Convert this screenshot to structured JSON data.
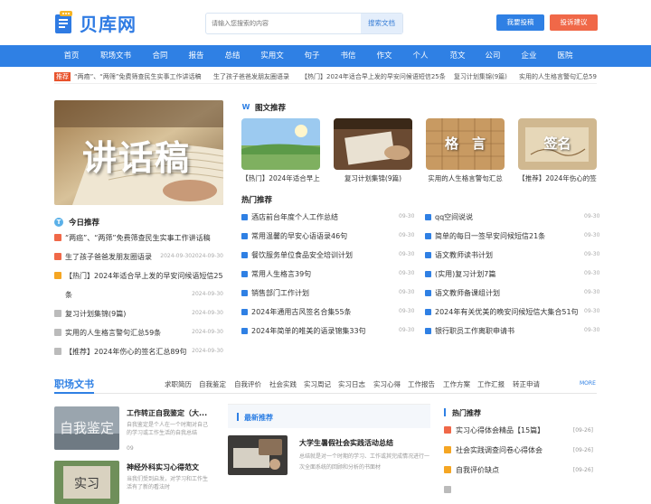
{
  "header": {
    "logo_text": "贝库网",
    "search_placeholder": "请输入您搜索的内容",
    "search_button": "搜索文档",
    "submit_button": "我要投稿",
    "complain_button": "投诉建议"
  },
  "colors": {
    "brand": "#2f80e4",
    "accent": "#f06848",
    "tag_red": "#e8532c"
  },
  "nav": [
    "首页",
    "职场文书",
    "合同",
    "报告",
    "总结",
    "实用文",
    "句子",
    "书信",
    "作文",
    "个人",
    "范文",
    "公司",
    "企业",
    "医院"
  ],
  "ticker": {
    "tag": "推荐",
    "items": [
      "“两癌”、“两筛”免费筛查民生实事工作讲话稿",
      "生了孩子爸爸发朋友圈语录",
      "【热门】2024年适合早上发的早安问候语短信25条",
      "复习计划集锦(9篇)",
      "实用的人生格言警句汇总59"
    ]
  },
  "hero": {
    "text": "讲话稿"
  },
  "today": {
    "title": "今日推荐",
    "icon": "T",
    "items": [
      {
        "text": "“两癌”、“两筛”免费筛查民生实事工作讲话稿",
        "date": ""
      },
      {
        "text": "生了孩子爸爸发朋友圈语录",
        "date": "2024-09-302024-09-30"
      },
      {
        "text": "【热门】2024年适合早上发的早安问候语短信25",
        "date": ""
      },
      {
        "text": "条",
        "date": "2024-09-30"
      },
      {
        "text": "复习计划集锦(9篇)",
        "date": "2024-09-30"
      },
      {
        "text": "实用的人生格言警句汇总59条",
        "date": "2024-09-30"
      },
      {
        "text": "【推荐】2024年伤心的签名汇总89句",
        "date": "2024-09-30"
      }
    ]
  },
  "pictures": {
    "title": "图文推荐",
    "icon": "W",
    "cards": [
      {
        "caption": "【热门】2024年适合早上",
        "icon": "sky-meadow-photo",
        "overlay": ""
      },
      {
        "caption": "复习计划集锦(9篇)",
        "icon": "desk-writing-photo",
        "overlay": ""
      },
      {
        "caption": "实用的人生格言警句汇总",
        "icon": "calligraphy-photo",
        "overlay": "格　言"
      },
      {
        "caption": "【推荐】2024年伤心的签",
        "icon": "signature-photo",
        "overlay": "签名"
      }
    ]
  },
  "hot": {
    "title": "热门推荐",
    "left": [
      {
        "text": "酒店前台年度个人工作总结",
        "date": "09-30"
      },
      {
        "text": "常用温馨的早安心语语录46句",
        "date": "09-30"
      },
      {
        "text": "餐饮服务单位食品安全培训计划",
        "date": "09-30"
      },
      {
        "text": "常用人生格言39句",
        "date": "09-30"
      },
      {
        "text": "销售部门工作计划",
        "date": "09-30"
      },
      {
        "text": "2024年通用古风签名合集55条",
        "date": "09-30"
      },
      {
        "text": "2024年简单的唯美的语录锦集33句",
        "date": "09-30"
      }
    ],
    "right": [
      {
        "text": "qq空间说说",
        "date": "09-30"
      },
      {
        "text": "简单的每日一签早安问候短信21条",
        "date": "09-30"
      },
      {
        "text": "语文教师读书计划",
        "date": "09-30"
      },
      {
        "text": "(实用)复习计划7篇",
        "date": "09-30"
      },
      {
        "text": "语文教师备课组计划",
        "date": "09-30"
      },
      {
        "text": "2024年有关优美的晚安问候短信大集合51句",
        "date": "09-30"
      },
      {
        "text": "银行职员工作离职申请书",
        "date": "09-30"
      }
    ]
  },
  "workplace": {
    "title": "职场文书",
    "tabs": [
      "求职简历",
      "自我鉴定",
      "自我评价",
      "社会实践",
      "实习周记",
      "实习日志",
      "实习心得",
      "工作报告",
      "工作方案",
      "工作汇报",
      "转正申请"
    ],
    "more": "MORE",
    "articles": [
      {
        "title": "工作转正自我鉴定（大...",
        "desc": "自我鉴定是个人在一个时期对自己的学习或工作生活的自我总结",
        "date": "09",
        "image_text": "自我鉴定"
      },
      {
        "title": "神经外科实习心得范文",
        "desc": "当我们受到启发，对学习和工作生活有了新的看法时",
        "date": "",
        "image_text": "实习"
      }
    ],
    "latest": {
      "title": "最新推荐",
      "article_title": "大学生暑假社会实践活动总结",
      "article_desc": "总结就是对一个时期的学习、工作或其完成情况进行一次全面系统的回顾和分析的书面材"
    },
    "hot": {
      "title": "热门推荐",
      "items": [
        {
          "text": "实习心得体会精品【15篇】",
          "date": "[09-26]"
        },
        {
          "text": "社会实践调查问卷心得体会",
          "date": "[09-26]"
        },
        {
          "text": "自我评价缺点",
          "date": "[09-26]"
        },
        {
          "text": "",
          "date": ""
        }
      ]
    }
  }
}
